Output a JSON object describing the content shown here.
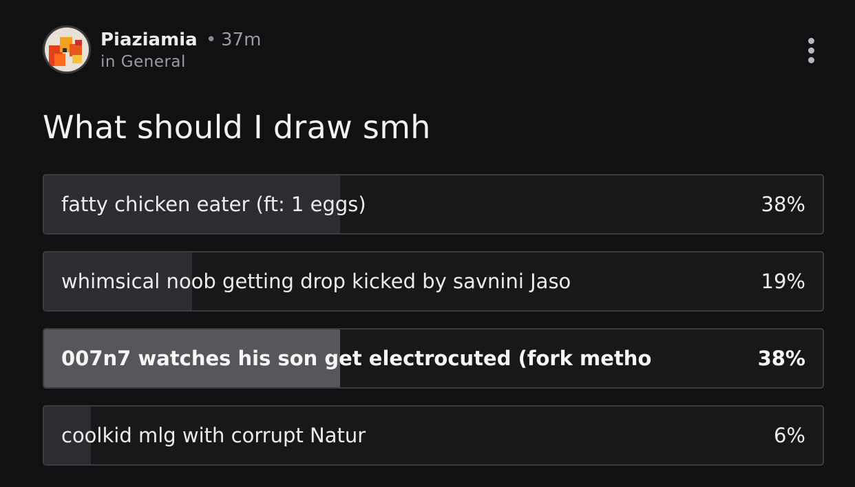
{
  "post": {
    "author": "Piaziamia",
    "separator": "•",
    "time_ago": "37m",
    "community": "in General",
    "title": "What should I draw smh"
  },
  "poll": {
    "options": [
      {
        "label": "fatty chicken eater (ft: 1 eggs)",
        "percent_label": "38%",
        "percent": 38,
        "selected": false
      },
      {
        "label": "whimsical noob getting drop kicked by savnini Jaso",
        "percent_label": "19%",
        "percent": 19,
        "selected": false
      },
      {
        "label": "007n7 watches his son get electrocuted (fork metho",
        "percent_label": "38%",
        "percent": 38,
        "selected": true
      },
      {
        "label": "coolkid mlg with corrupt Natur",
        "percent_label": "6%",
        "percent": 6,
        "selected": false
      }
    ]
  },
  "icons": {
    "more": "more-vertical-icon",
    "avatar": "avatar-image"
  },
  "colors": {
    "background": "#111114",
    "option_fill": "#2d2d31",
    "option_fill_selected": "#56565b",
    "option_border": "#3c3c40"
  }
}
